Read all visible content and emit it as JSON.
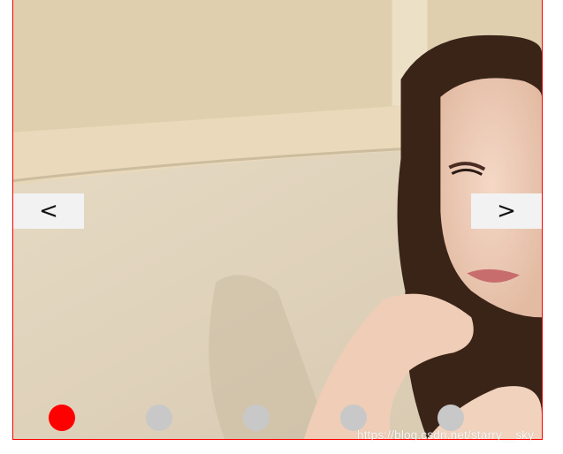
{
  "carousel": {
    "prev_label": "<",
    "next_label": ">",
    "indicator_count": 5,
    "active_index": 0
  },
  "colors": {
    "border": "#ff0000",
    "active_dot": "#ff0000",
    "inactive_dot": "#c8c8c8",
    "arrow_bg": "#f2f2f2"
  },
  "watermark": "https://blog.csdn.net/starry__sky"
}
